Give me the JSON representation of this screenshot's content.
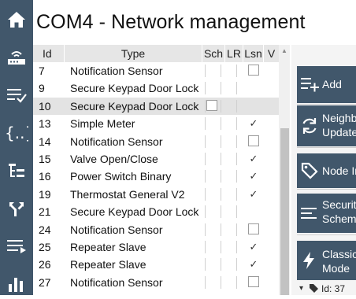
{
  "window": {
    "title": "COM4 - Network management"
  },
  "nav": {
    "items": [
      {
        "name": "home-icon"
      },
      {
        "name": "router-icon"
      },
      {
        "name": "checklist-icon"
      },
      {
        "name": "json-braces-icon"
      },
      {
        "name": "tree-list-icon"
      },
      {
        "name": "routing-icon"
      },
      {
        "name": "log-list-icon"
      },
      {
        "name": "bar-chart-icon"
      }
    ]
  },
  "table": {
    "columns": [
      "Id",
      "Type",
      "Sch",
      "LR",
      "Lsn",
      "V"
    ],
    "rows": [
      {
        "id": "7",
        "type": "Notification Sensor",
        "lsn": "box"
      },
      {
        "id": "9",
        "type": "Secure Keypad Door Lock",
        "lsn": "none"
      },
      {
        "id": "10",
        "type": "Secure Keypad Door Lock",
        "lsn": "none",
        "selected": true
      },
      {
        "id": "13",
        "type": "Simple Meter",
        "lsn": "check"
      },
      {
        "id": "14",
        "type": "Notification Sensor",
        "lsn": "box"
      },
      {
        "id": "15",
        "type": "Valve Open/Close",
        "lsn": "check"
      },
      {
        "id": "16",
        "type": "Power Switch Binary",
        "lsn": "check"
      },
      {
        "id": "19",
        "type": "Thermostat General V2",
        "lsn": "check"
      },
      {
        "id": "21",
        "type": "Secure Keypad Door Lock",
        "lsn": "none"
      },
      {
        "id": "24",
        "type": "Notification Sensor",
        "lsn": "box"
      },
      {
        "id": "25",
        "type": "Repeater Slave",
        "lsn": "check"
      },
      {
        "id": "26",
        "type": "Repeater Slave",
        "lsn": "check"
      },
      {
        "id": "27",
        "type": "Notification Sensor",
        "lsn": "box"
      }
    ],
    "check_glyph": "✓"
  },
  "actions": {
    "add": "Add",
    "neighbors_update": [
      "Neighbors",
      "Update"
    ],
    "node_info": "Node Info",
    "security_scheme": [
      "Security",
      "Scheme"
    ],
    "classic_mode": [
      "Classic",
      "Mode"
    ]
  },
  "status": {
    "selected_id": "Id: 37"
  },
  "colors": {
    "rail": "#41576b",
    "accent": "#41576b",
    "selected_row": "#e3e3e3"
  }
}
